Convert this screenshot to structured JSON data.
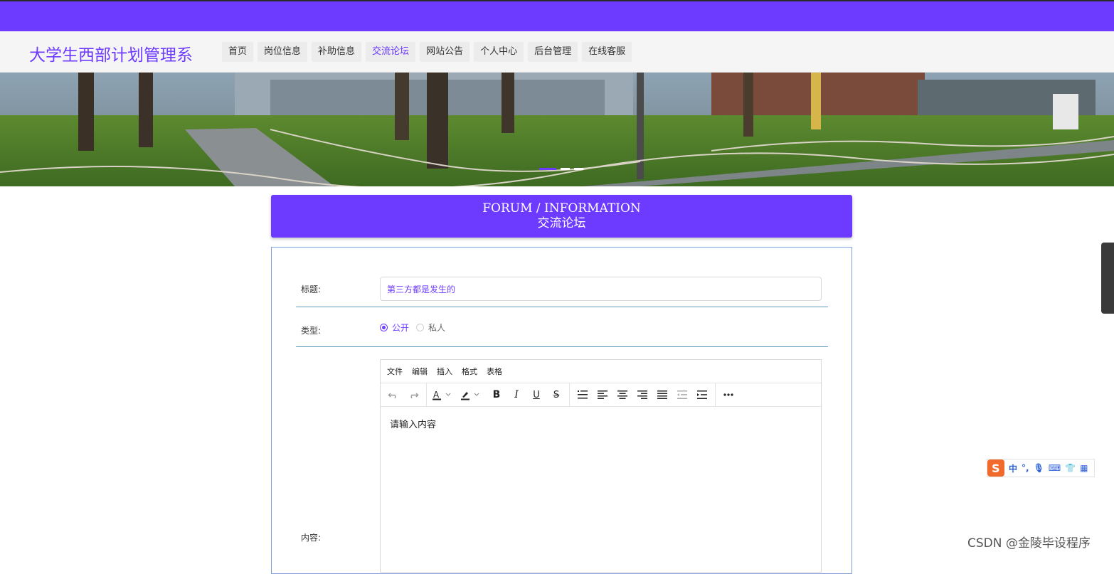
{
  "brand": {
    "title": "大学生西部计划管理系"
  },
  "nav": {
    "items": [
      {
        "label": "首页",
        "active": false
      },
      {
        "label": "岗位信息",
        "active": false
      },
      {
        "label": "补助信息",
        "active": false
      },
      {
        "label": "交流论坛",
        "active": true
      },
      {
        "label": "网站公告",
        "active": false
      },
      {
        "label": "个人中心",
        "active": false
      },
      {
        "label": "后台管理",
        "active": false
      },
      {
        "label": "在线客服",
        "active": false
      }
    ]
  },
  "carousel": {
    "slide_count": 3,
    "active_index": 0
  },
  "forum": {
    "title_en": "FORUM / INFORMATION",
    "title_cn": "交流论坛"
  },
  "form": {
    "title_label": "标题:",
    "title_value": "第三方都是发生的",
    "type_label": "类型:",
    "type_options": [
      {
        "label": "公开",
        "checked": true
      },
      {
        "label": "私人",
        "checked": false
      }
    ],
    "content_label": "内容:",
    "editor": {
      "menus": [
        "文件",
        "编辑",
        "插入",
        "格式",
        "表格"
      ],
      "placeholder": "请输入内容",
      "tool_icons": [
        "undo-icon",
        "redo-icon",
        "font-color-icon",
        "highlight-color-icon",
        "bold-icon",
        "italic-icon",
        "underline-icon",
        "strikethrough-icon",
        "list-icon",
        "align-left-icon",
        "align-center-icon",
        "align-right-icon",
        "align-justify-icon",
        "outdent-icon",
        "indent-icon",
        "more-icon"
      ]
    }
  },
  "ime": {
    "labels": [
      "中",
      "°,",
      "🎙",
      "⌨",
      "👕",
      "▦"
    ]
  },
  "watermark": {
    "text": "CSDN @金陵毕设程序"
  },
  "colors": {
    "accent": "#6d3bff",
    "line": "#5b9bbd",
    "border": "#7fa0d8"
  }
}
